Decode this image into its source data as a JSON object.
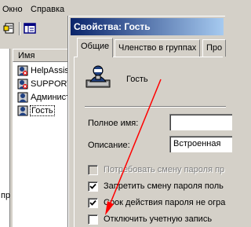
{
  "menubar": {
    "items": [
      "Окно",
      "Справка"
    ]
  },
  "list": {
    "header": "Имя",
    "items": [
      {
        "label": "HelpAssist",
        "disabled": true
      },
      {
        "label": "SUPPORT_",
        "disabled": true
      },
      {
        "label": "Админист",
        "disabled": false
      },
      {
        "label": "Гость",
        "disabled": false,
        "selected": true
      }
    ]
  },
  "tree": {
    "fragment": "пр"
  },
  "dialog": {
    "title": "Свойства: Гость",
    "tabs": [
      "Общие",
      "Членство в группах",
      "Про"
    ],
    "user_name": "Гость",
    "full_name_label": "Полное имя:",
    "full_name_value": "",
    "description_label": "Описание:",
    "description_value": "Встроенная",
    "checkboxes": [
      {
        "label": "Потребовать смену пароля пр",
        "checked": false,
        "disabled": true
      },
      {
        "label": "Запретить смену пароля поль",
        "checked": true,
        "disabled": false
      },
      {
        "label": "Срок действия пароля не огра",
        "checked": true,
        "disabled": false
      },
      {
        "label": "Отключить учетную запись",
        "checked": false,
        "disabled": false
      }
    ]
  },
  "colors": {
    "titlebar_start": "#0a246a",
    "titlebar_end": "#a6caf0",
    "annotation_arrow": "#ff0000",
    "face": "#d4d0c8"
  }
}
